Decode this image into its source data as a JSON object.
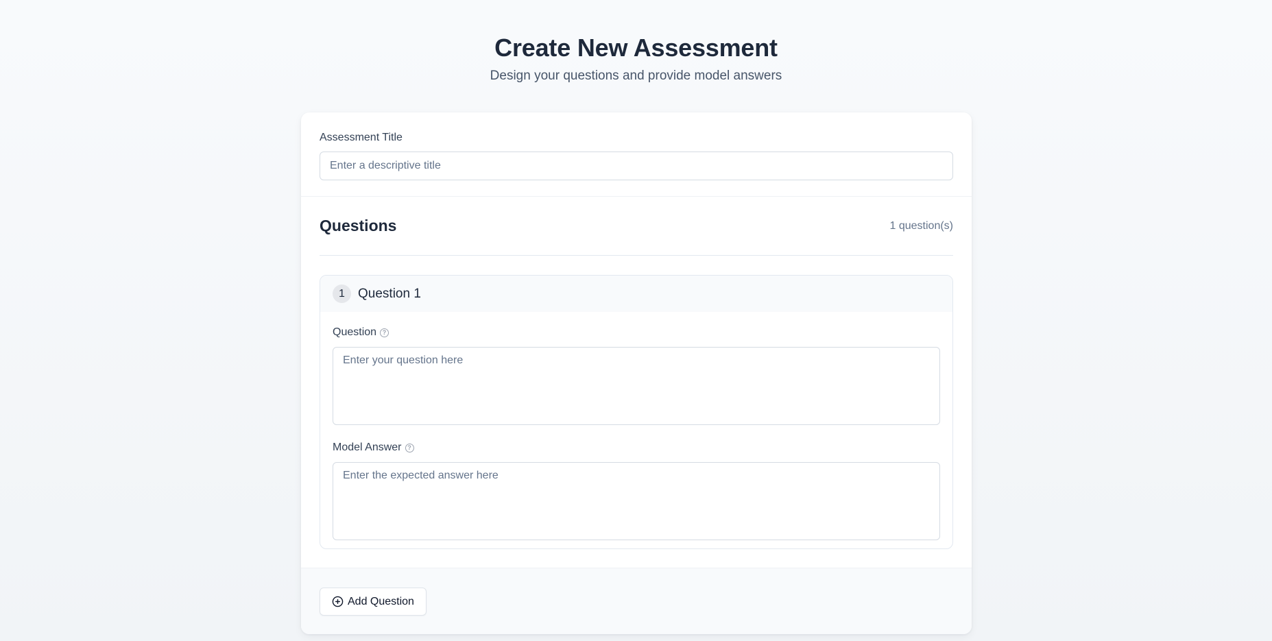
{
  "header": {
    "title": "Create New Assessment",
    "subtitle": "Design your questions and provide model answers"
  },
  "assessment": {
    "title_label": "Assessment Title",
    "title_value": "",
    "title_placeholder": "Enter a descriptive title"
  },
  "questions": {
    "heading": "Questions",
    "count_text": "1 question(s)",
    "items": [
      {
        "number": "1",
        "title": "Question 1",
        "question_label": "Question",
        "question_value": "",
        "question_placeholder": "Enter your question here",
        "answer_label": "Model Answer",
        "answer_value": "",
        "answer_placeholder": "Enter the expected answer here"
      }
    ]
  },
  "footer": {
    "add_question_label": "Add Question"
  },
  "icons": {
    "help": "help-circle-icon",
    "add": "plus-circle-icon"
  },
  "colors": {
    "background": "#f8fafc",
    "card": "#ffffff",
    "text_primary": "#1e293b",
    "text_secondary": "#64748b",
    "border": "#d5dbe3"
  }
}
